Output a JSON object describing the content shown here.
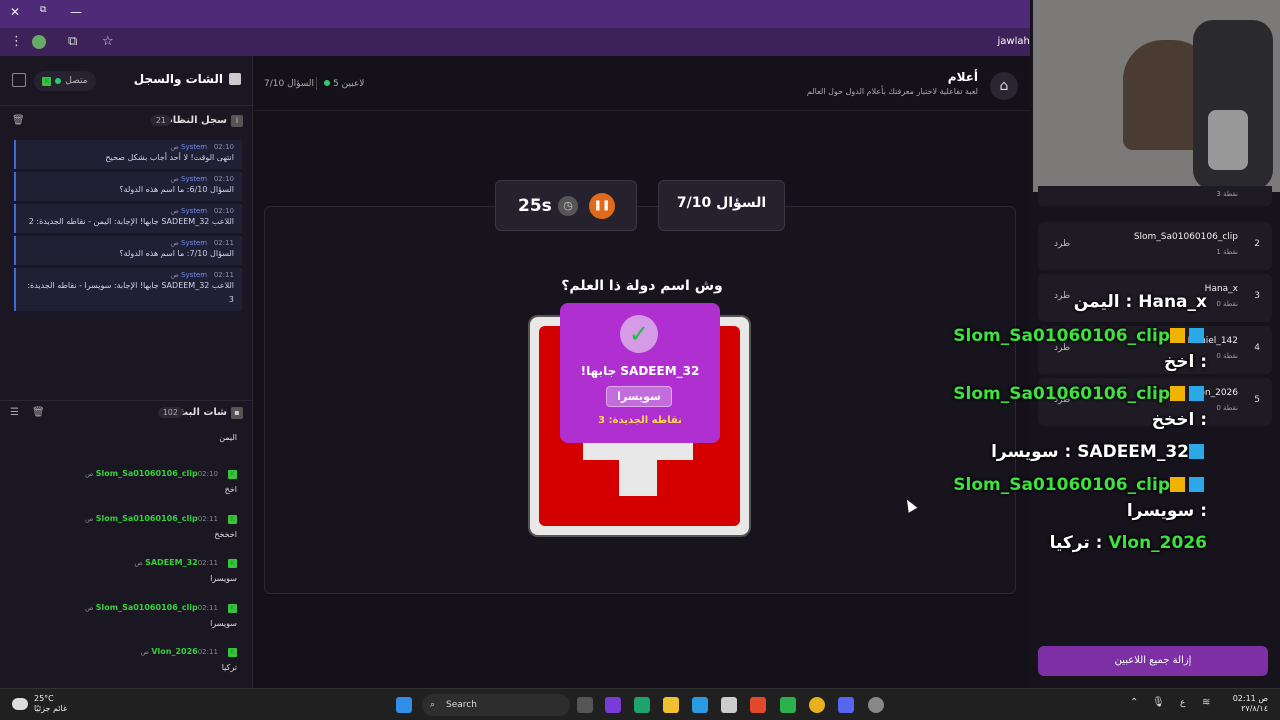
{
  "browser": {
    "url": "jawlah.",
    "close": "✕",
    "tabs_icon": "⧉",
    "minimize": "—"
  },
  "left_panel": {
    "title": "الشات والسجل",
    "status": "متصل",
    "system_log": {
      "label": "سجل النظام",
      "count": "21",
      "messages": [
        {
          "sender": "System",
          "time": "02:10 ص",
          "text": "انتهى الوقت! لا أحد أجاب بشكل صحيح"
        },
        {
          "sender": "System",
          "time": "02:10 ص",
          "text": "السؤال 6/10: ما اسم هذه الدولة؟"
        },
        {
          "sender": "System",
          "time": "02:10 ص",
          "text": "اللاعب SADEEM_32 جابها! الإجابة: اليمن - نقاطه الجديدة: 2"
        },
        {
          "sender": "System",
          "time": "02:11 ص",
          "text": "السؤال 7/10: ما اسم هذه الدولة؟"
        },
        {
          "sender": "System",
          "time": "02:11 ص",
          "text": "اللاعب SADEEM_32 جابها! الإجابة: سويسرا - نقاطه الجديدة: 3"
        }
      ]
    },
    "stream_chat": {
      "label": "شات البث",
      "count": "102",
      "first_body": "اليمن",
      "messages": [
        {
          "user": "Slom_Sa01060106_clip",
          "time": "02:10 ص",
          "text": "اخخ"
        },
        {
          "user": "Slom_Sa01060106_clip",
          "time": "02:11 ص",
          "text": "اخخخخ"
        },
        {
          "user": "SADEEM_32",
          "time": "02:11 ص",
          "text": "سويسرا"
        },
        {
          "user": "Slom_Sa01060106_clip",
          "time": "02:11 ص",
          "text": "سويسرا"
        },
        {
          "user": "Vlon_2026",
          "time": "02:11 ص",
          "text": "تركيا"
        }
      ]
    }
  },
  "header": {
    "title": "أعلام",
    "subtitle": "لعبة تفاعلية لاختبار معرفتك بأعلام الدول حول العالم",
    "players": "5 لاعبين",
    "question_counter": "السؤال 7/10"
  },
  "game": {
    "timer": "25s",
    "question_pill": "السؤال 7/10",
    "question": "وش اسم دولة ذا العلم؟",
    "winner_text": "SADEEM_32 جابها!",
    "answer": "سويسرا",
    "new_points": "نقاطه الجديدة: 3",
    "flag_colors": {
      "red": "#d40000",
      "white": "#e8e8e8"
    }
  },
  "players_list": [
    {
      "rank": "",
      "name": "",
      "points": "3 نقطة",
      "kick": ""
    },
    {
      "rank": "2",
      "name": "Slom_Sa01060106_clip",
      "points": "1 نقطة",
      "kick": "طرد"
    },
    {
      "rank": "3",
      "name": "Hana_x",
      "points": "0 نقطة",
      "kick": "طرد"
    },
    {
      "rank": "4",
      "name": "Daniel_142",
      "points": "0 نقطة",
      "kick": "طرد"
    },
    {
      "rank": "5",
      "name": "Vlon_2026",
      "points": "0 نقطة",
      "kick": "طرد"
    }
  ],
  "clear_button": "إزالة جميع اللاعبين",
  "overlay_chat": [
    {
      "name": "Hana_x",
      "msg": "اليمن"
    },
    {
      "name": "Slom_Sa01060106_clip",
      "msg": "اخخ"
    },
    {
      "name": "Slom_Sa01060106_clip",
      "msg": "اخخخ"
    },
    {
      "name": "SADEEM_32",
      "msg": "سويسرا"
    },
    {
      "name": "Slom_Sa01060106_clip",
      "msg": "سويسرا"
    },
    {
      "name": "Vlon_2026",
      "msg": "تركيا"
    }
  ],
  "taskbar": {
    "temp": "25°C",
    "weather": "غائم جزئيًا",
    "search": "Search",
    "lang": "ع",
    "time": "02:11 ص",
    "date": "٢٧/٨/١٤"
  }
}
